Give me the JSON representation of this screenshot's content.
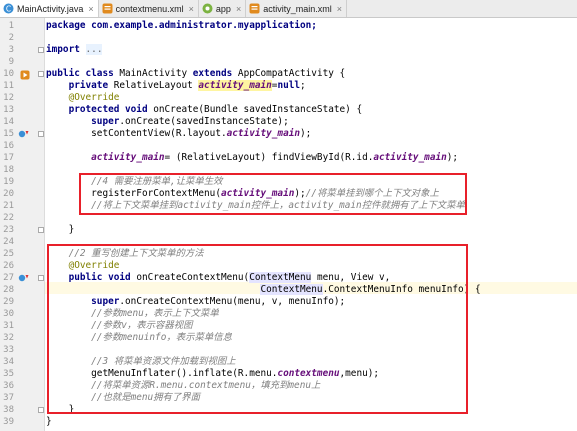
{
  "tabs": [
    {
      "label": "MainActivity.java",
      "close": "×",
      "active": true,
      "icon": "java-class-icon"
    },
    {
      "label": "contextmenu.xml",
      "close": "×",
      "active": false,
      "icon": "xml-layout-icon"
    },
    {
      "label": "app",
      "close": "×",
      "active": false,
      "icon": "android-module-icon"
    },
    {
      "label": "activity_main.xml",
      "close": "×",
      "active": false,
      "icon": "xml-layout-icon"
    }
  ],
  "line_numbers": [
    "1",
    "2",
    "3",
    "9",
    "10",
    "11",
    "12",
    "13",
    "14",
    "15",
    "16",
    "17",
    "18",
    "19",
    "20",
    "21",
    "22",
    "23",
    "24",
    "25",
    "26",
    "27",
    "28",
    "29",
    "30",
    "31",
    "32",
    "33",
    "34",
    "35",
    "36",
    "37",
    "38",
    "39"
  ],
  "code": {
    "l1": [
      "package com.example.administrator.myapplication;"
    ],
    "l3": [
      "import",
      " ",
      "..."
    ],
    "l10": [
      "public class",
      " MainActivity ",
      "extends",
      " AppCompatActivity {"
    ],
    "l11": [
      "    ",
      "private",
      " RelativeLayout ",
      "activity_main",
      "=",
      "null",
      ";"
    ],
    "l12": [
      "    @Override"
    ],
    "l13": [
      "    ",
      "protected void",
      " onCreate(Bundle savedInstanceState) {"
    ],
    "l14": [
      "        ",
      "super",
      ".onCreate(savedInstanceState);"
    ],
    "l15": [
      "        setContentView(R.layout.",
      "activity_main",
      ");"
    ],
    "l17": [
      "        ",
      "activity_main",
      "= (RelativeLayout) findViewById(R.id.",
      "activity_main",
      ");"
    ],
    "l19": [
      "        //4 需要注册菜单,让菜单生效"
    ],
    "l20": [
      "        registerForContextMenu(",
      "activity_main",
      ");",
      "//将菜单挂到哪个上下文对象上"
    ],
    "l21": [
      "        //将上下文菜单挂到activity_main控件上，activity_main控件就拥有了上下文菜单"
    ],
    "l23": [
      "    }"
    ],
    "l25": [
      "    //2 重写创建上下文菜单的方法"
    ],
    "l26": [
      "    @Override"
    ],
    "l27": [
      "    ",
      "public void",
      " onCreateContextMenu(",
      "ContextMenu",
      " menu, View v,"
    ],
    "l28": [
      "                                      ",
      "ContextMenu",
      ".ContextMenuInfo menuInfo) {"
    ],
    "l29": [
      "        ",
      "super",
      ".onCreateContextMenu(menu, v, menuInfo);"
    ],
    "l30": [
      "        //参数menu，表示上下文菜单"
    ],
    "l31": [
      "        //参数v，表示容器视图"
    ],
    "l32": [
      "        //参数menuinfo，表示菜单信息"
    ],
    "l34": [
      "        //3 将菜单资源文件加载到视图上"
    ],
    "l35": [
      "        getMenuInflater().inflate(R.menu.",
      "contextmenu",
      ",menu);"
    ],
    "l36": [
      "        //将菜单资源R.menu.contextmenu，填充到menu上"
    ],
    "l37": [
      "        //也就是menu拥有了界面"
    ],
    "l38": [
      "    }"
    ],
    "l39": [
      "}"
    ]
  },
  "colors": {
    "keyword": "#000080",
    "annotation": "#808000",
    "comment": "#808080",
    "field": "#660e7a",
    "highlight_box": "#e8202a",
    "caret_line": "#fffae3"
  }
}
